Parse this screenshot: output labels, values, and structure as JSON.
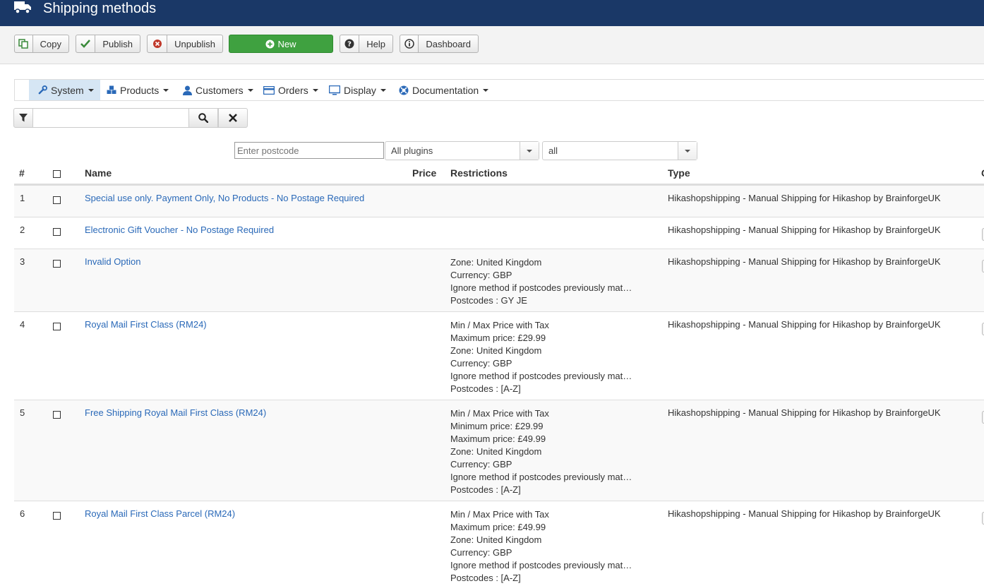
{
  "header": {
    "title": "Shipping methods",
    "icon": "truck-icon"
  },
  "toolbar": {
    "copy": "Copy",
    "publish": "Publish",
    "unpublish": "Unpublish",
    "new": "New",
    "help": "Help",
    "dashboard": "Dashboard"
  },
  "menu": {
    "items": [
      {
        "label": "System",
        "icon": "wrench-icon"
      },
      {
        "label": "Products",
        "icon": "cubes-icon"
      },
      {
        "label": "Customers",
        "icon": "user-icon"
      },
      {
        "label": "Orders",
        "icon": "credit-card-icon"
      },
      {
        "label": "Display",
        "icon": "monitor-icon"
      },
      {
        "label": "Documentation",
        "icon": "lifebuoy-icon"
      }
    ]
  },
  "filters": {
    "search_value": "",
    "postcode_placeholder": "Enter postcode",
    "plugins_selected": "All plugins",
    "published_selected": "all"
  },
  "table": {
    "headers": {
      "num": "#",
      "name": "Name",
      "price": "Price",
      "restrictions": "Restrictions",
      "type": "Type",
      "cut": "C"
    },
    "rows": [
      {
        "num": "1",
        "name": "Special use only. Payment Only, No Products - No Postage Required",
        "restrictions": [],
        "type": "Hikashopshipping - Manual Shipping for Hikashop by BrainforgeUK"
      },
      {
        "num": "2",
        "name": "Electronic Gift Voucher - No Postage Required",
        "restrictions": [],
        "type": "Hikashopshipping - Manual Shipping for Hikashop by BrainforgeUK"
      },
      {
        "num": "3",
        "name": "Invalid Option",
        "restrictions": [
          "Zone: United Kingdom",
          "Currency: GBP",
          "Ignore method if postcodes previously matched",
          "Postcodes : GY JE"
        ],
        "type": "Hikashopshipping - Manual Shipping for Hikashop by BrainforgeUK"
      },
      {
        "num": "4",
        "name": "Royal Mail First Class (RM24)",
        "restrictions": [
          "Min / Max Price with Tax",
          "Maximum price: £29.99",
          "Zone: United Kingdom",
          "Currency: GBP",
          "Ignore method if postcodes previously matched",
          "Postcodes : [A-Z]"
        ],
        "type": "Hikashopshipping - Manual Shipping for Hikashop by BrainforgeUK"
      },
      {
        "num": "5",
        "name": "Free Shipping Royal Mail First Class (RM24)",
        "restrictions": [
          "Min / Max Price with Tax",
          "Minimum price: £29.99",
          "Maximum price: £49.99",
          "Zone: United Kingdom",
          "Currency: GBP",
          "Ignore method if postcodes previously matched",
          "Postcodes : [A-Z]"
        ],
        "type": "Hikashopshipping - Manual Shipping for Hikashop by BrainforgeUK"
      },
      {
        "num": "6",
        "name": "Royal Mail First Class Parcel (RM24)",
        "restrictions": [
          "Min / Max Price with Tax",
          "Maximum price: £49.99",
          "Zone: United Kingdom",
          "Currency: GBP",
          "Ignore method if postcodes previously matched",
          "Postcodes : [A-Z]"
        ],
        "type": "Hikashopshipping - Manual Shipping for Hikashop by BrainforgeUK"
      }
    ]
  },
  "colors": {
    "header_bg": "#1a3867",
    "new_button": "#3fa140",
    "link": "#2a69b8",
    "menu_active": "#d6e6f4"
  }
}
